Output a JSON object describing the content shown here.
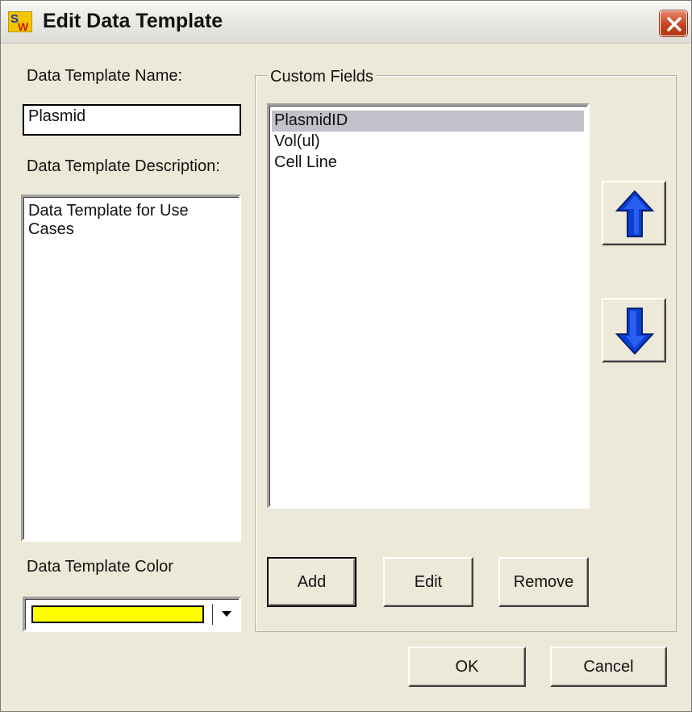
{
  "window": {
    "title": "Edit Data Template",
    "icon_letters": [
      "S",
      "W"
    ]
  },
  "form": {
    "name_label": "Data Template Name:",
    "name_value": "Plasmid",
    "description_label": "Data Template Description:",
    "description_value": "Data Template for Use Cases",
    "color_label": "Data Template Color",
    "color_value": "#ffff00"
  },
  "custom_fields": {
    "group_label": "Custom Fields",
    "items": [
      "PlasmidID",
      "Vol(ul)",
      "Cell Line"
    ],
    "selected_index": 0,
    "add_label": "Add",
    "edit_label": "Edit",
    "remove_label": "Remove",
    "move_up_icon": "arrow-up-icon",
    "move_down_icon": "arrow-down-icon"
  },
  "footer": {
    "ok_label": "OK",
    "cancel_label": "Cancel"
  },
  "colors": {
    "dialog_bg": "#ece9d8",
    "arrow_blue": "#0a3fd6",
    "close_red": "#c4401c",
    "selection": "#c2c1c9"
  }
}
